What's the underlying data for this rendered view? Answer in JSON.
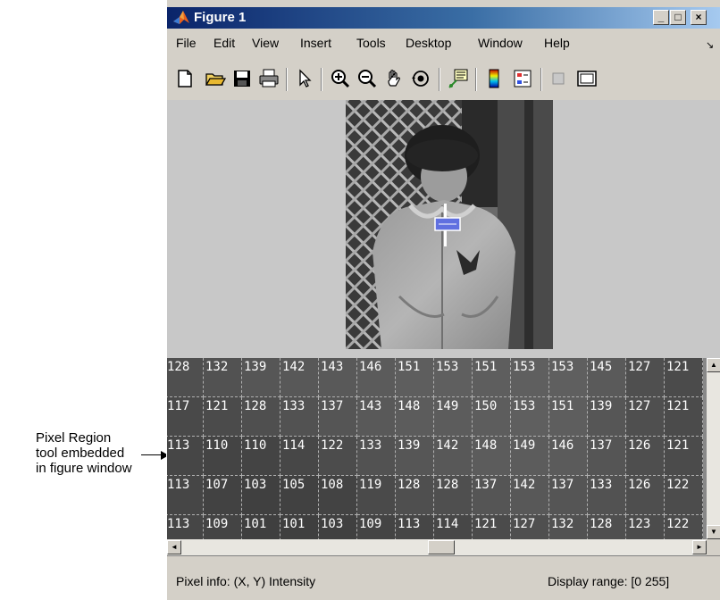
{
  "annotation": {
    "lines": [
      "Pixel Region",
      "tool embedded",
      "in figure window"
    ]
  },
  "window": {
    "title": "Figure 1",
    "buttons": {
      "minimize": "_",
      "maximize": "□",
      "close": "×"
    }
  },
  "menu": {
    "items": [
      "File",
      "Edit",
      "View",
      "Insert",
      "Tools",
      "Desktop",
      "Window",
      "Help"
    ],
    "dock_glyph": "↘"
  },
  "toolbar": {
    "icons": [
      "new-figure-icon",
      "open-file-icon",
      "save-icon",
      "print-icon",
      "pointer-icon",
      "zoom-in-icon",
      "zoom-out-icon",
      "pan-hand-icon",
      "rotate-3d-icon",
      "data-cursor-icon",
      "insert-colorbar-icon",
      "insert-legend-icon",
      "hide-plot-tools-icon",
      "show-plot-tools-icon"
    ]
  },
  "pixel_grid": {
    "rows": [
      [
        "128",
        "132",
        "139",
        "142",
        "143",
        "146",
        "151",
        "153",
        "151",
        "153",
        "153",
        "145",
        "127",
        "121"
      ],
      [
        "117",
        "121",
        "128",
        "133",
        "137",
        "143",
        "148",
        "149",
        "150",
        "153",
        "151",
        "139",
        "127",
        "121"
      ],
      [
        "113",
        "110",
        "110",
        "114",
        "122",
        "133",
        "139",
        "142",
        "148",
        "149",
        "146",
        "137",
        "126",
        "121"
      ],
      [
        "113",
        "107",
        "103",
        "105",
        "108",
        "119",
        "128",
        "128",
        "137",
        "142",
        "137",
        "133",
        "126",
        "122"
      ],
      [
        "113",
        "109",
        "101",
        "101",
        "103",
        "109",
        "113",
        "114",
        "121",
        "127",
        "132",
        "128",
        "123",
        "122"
      ]
    ]
  },
  "scroll": {
    "up": "▲",
    "down": "▼",
    "left": "◄",
    "right": "►"
  },
  "status": {
    "left": "Pixel info: (X, Y)  Intensity",
    "right": "Display range: [0 255]"
  }
}
